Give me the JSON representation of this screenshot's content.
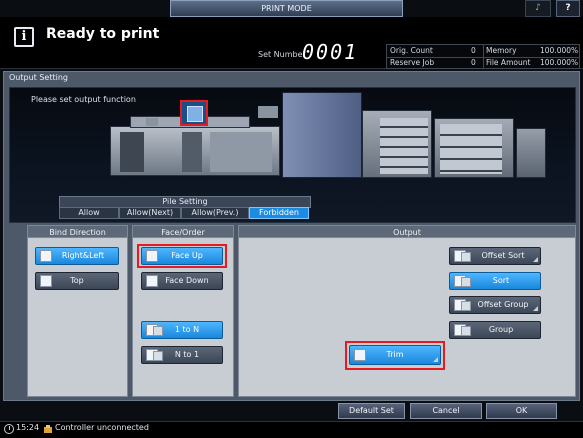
{
  "header": {
    "mode_tab": "PRINT MODE",
    "volume_icon": "speaker-icon",
    "help_label": "?",
    "status_text": "Ready to print",
    "set_number_label": "Set Number",
    "set_number_value": "0001"
  },
  "counters": {
    "orig_count_label": "Orig. Count",
    "orig_count_value": "0",
    "memory_label": "Memory",
    "memory_value": "100.000%",
    "reserve_job_label": "Reserve Job",
    "reserve_job_value": "0",
    "file_amount_label": "File Amount",
    "file_amount_value": "100.000%"
  },
  "panel": {
    "title": "Output Setting",
    "prompt": "Please set output function"
  },
  "pile_setting": {
    "title": "Pile Setting",
    "options": [
      "Allow",
      "Allow(Next)",
      "Allow(Prev.)",
      "Forbidden"
    ],
    "selected": "Forbidden"
  },
  "bind_direction": {
    "title": "Bind Direction",
    "right_left": "Right&Left",
    "top": "Top",
    "selected": "Right&Left"
  },
  "face_order": {
    "title": "Face/Order",
    "face_up": "Face Up",
    "face_down": "Face Down",
    "one_to_n": "1 to N",
    "n_to_one": "N to 1",
    "selected_face": "Face Up",
    "selected_order": "1 to N"
  },
  "output": {
    "title": "Output",
    "offset_sort": "Offset Sort",
    "sort": "Sort",
    "offset_group": "Offset Group",
    "group": "Group",
    "trim": "Trim",
    "selected": "Sort"
  },
  "footer": {
    "default_set": "Default Set",
    "cancel": "Cancel",
    "ok": "OK",
    "time": "15:24",
    "controller_status": "Controller unconnected"
  },
  "colors": {
    "selected_blue": "#1d8ce0",
    "highlight_red": "#e31b23",
    "panel_bg": "#4d5868"
  }
}
